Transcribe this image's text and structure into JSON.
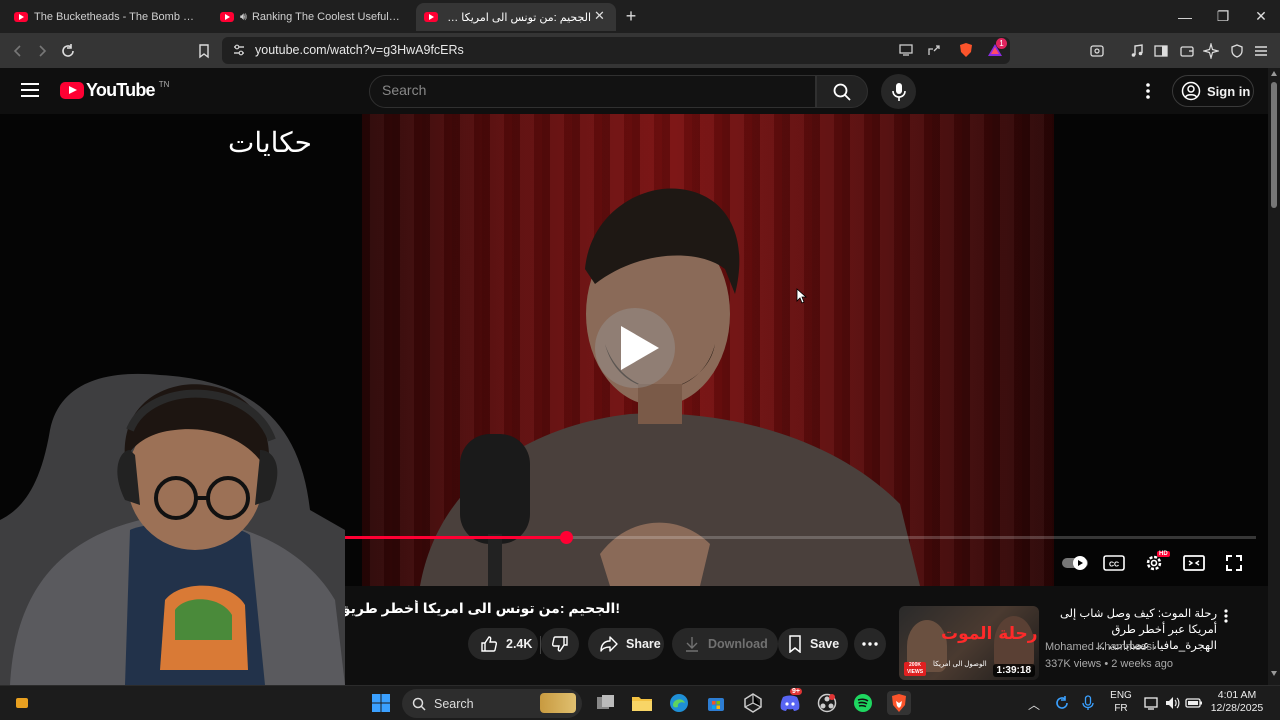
{
  "browser": {
    "tabs": [
      {
        "title": "The Bucketheads - The Bomb [These",
        "active": false
      },
      {
        "title": "Ranking The Coolest Useful Car F",
        "active": false,
        "audio": true
      },
      {
        "title": "الجحيم :من تونس الى امريكا أخطر",
        "active": true
      }
    ],
    "new_tab_label": "+",
    "url": "youtube.com/watch?v=g3HwA9fcERs",
    "brave_badge": "",
    "alert_badge": "1"
  },
  "youtube": {
    "logo_text": "YouTube",
    "region": "TN",
    "search_placeholder": "Search",
    "signin_label": "Sign in"
  },
  "video": {
    "watermark": "حكايات",
    "progress_fraction": 0.445,
    "quality_badge": "HD",
    "title": "!الجحيم :من تونس الى امريكا أخطر طريق للهجرة غ"
  },
  "actions": {
    "like_count": "2.4K",
    "share_label": "Share",
    "download_label": "Download",
    "save_label": "Save"
  },
  "recommendation": {
    "title": "رحلة الموت: كيف وصل شاب إلى أمريكا عبر أخطر طرق الهجرة_مافيا، عصابات، ...",
    "channel": "Mohamed Khammessi",
    "views": "337K views",
    "age": "2 weeks ago",
    "duration": "1:39:18",
    "thumb_text": "رحلة الموت",
    "thumb_sub": "الوصول الى امريكا",
    "thumb_badge": "200K VIEWS"
  },
  "taskbar": {
    "search_label": "Search",
    "lang_top": "ENG",
    "lang_bottom": "FR",
    "time": "4:01 AM",
    "date": "12/28/2025",
    "discord_badge": "9+"
  },
  "colors": {
    "youtube_red": "#ff0033",
    "bg": "#0f0f0f"
  }
}
